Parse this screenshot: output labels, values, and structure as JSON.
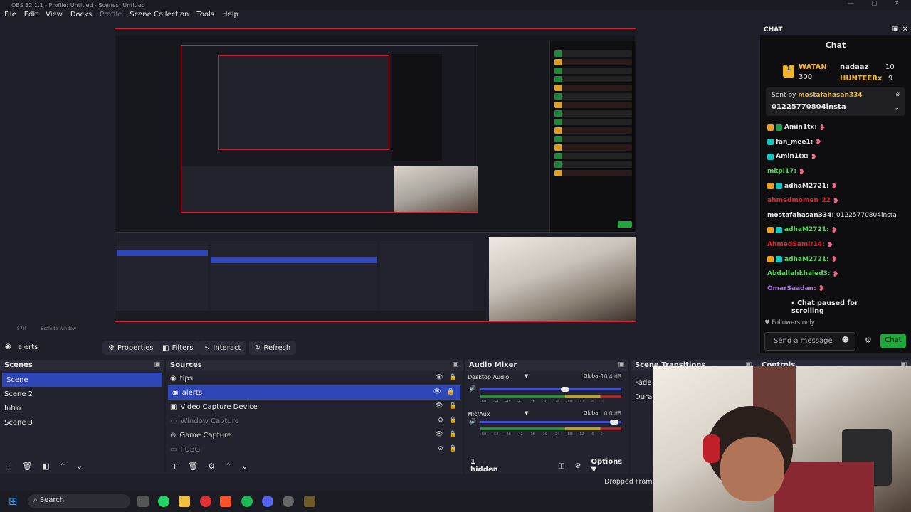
{
  "window": {
    "title": "OBS 32.1.1 - Profile: Untitled - Scenes: Untitled"
  },
  "menu": [
    "File",
    "Edit",
    "View",
    "Docks",
    "Profile",
    "Scene Collection",
    "Tools",
    "Help"
  ],
  "zoom": {
    "percent": "57%",
    "mode": "Scale to Window"
  },
  "toolbar": {
    "current_source": "alerts",
    "properties": "Properties",
    "filters": "Filters",
    "interact": "Interact",
    "refresh": "Refresh"
  },
  "scenes": {
    "title": "Scenes",
    "items": [
      "Scene",
      "Scene 2",
      "Intro",
      "Scene 3"
    ],
    "selected": "Scene"
  },
  "sources": {
    "title": "Sources",
    "items": [
      {
        "label": "tips",
        "icon": "browser-icon"
      },
      {
        "label": "alerts",
        "icon": "browser-icon"
      },
      {
        "label": "Video Capture Device",
        "icon": "camera-icon"
      },
      {
        "label": "Window Capture",
        "icon": "window-icon"
      },
      {
        "label": "Game Capture",
        "icon": "gamepad-icon"
      },
      {
        "label": "PUBG",
        "icon": "window-icon"
      }
    ],
    "selected": "alerts"
  },
  "mixer": {
    "title": "Audio Mixer",
    "channels": [
      {
        "name": "Desktop Audio",
        "scope": "Global",
        "db": "-10.4 dB",
        "level": 0.6
      },
      {
        "name": "Mic/Aux",
        "scope": "Global",
        "db": "0.0 dB",
        "level": 0.95
      }
    ],
    "ticks": [
      "-60",
      "-54",
      "-48",
      "-42",
      "-36",
      "-30",
      "-24",
      "-18",
      "-12",
      "-6",
      "0"
    ],
    "hidden": "1 hidden",
    "options": "Options"
  },
  "transitions": {
    "title": "Scene Transitions",
    "value": "Fade",
    "duration_label": "Duration"
  },
  "controls": {
    "title": "Controls"
  },
  "status": {
    "dropped": "Dropped Frames"
  },
  "taskbar": {
    "search": "Search"
  },
  "chat_dock": {
    "dock_title": "CHAT",
    "header": "Chat",
    "leaderboard": [
      {
        "name": "WATAN",
        "points": "300"
      },
      {
        "name": "nadaaz",
        "points": "10"
      },
      {
        "name": "HUNTEERx",
        "points": "9"
      }
    ],
    "pinned": {
      "sent_by_prefix": "Sent by",
      "sender": "mostafahasan334",
      "message": "01225770804insta"
    },
    "messages": [
      {
        "user": "Amin1tx:",
        "color": "#e6e6e6",
        "badges": [
          "by",
          "bg"
        ]
      },
      {
        "user": "fan_mee1:",
        "color": "#e6e6e6",
        "badges": [
          "bt"
        ]
      },
      {
        "user": "Amin1tx:",
        "color": "#e6e6e6",
        "badges": [
          "bt"
        ]
      },
      {
        "user": "mkpl17:",
        "color": "#5fd35f",
        "badges": []
      },
      {
        "user": "adhaM2721:",
        "color": "#e6e6e6",
        "badges": [
          "by",
          "bt"
        ]
      },
      {
        "user": "ahmedmomen_22",
        "color": "#e0222e",
        "badges": []
      },
      {
        "user": "mostafahasan334:",
        "color": "#e6e6e6",
        "badges": [],
        "text": "01225770804insta"
      },
      {
        "user": "adhaM2721:",
        "color": "#5fd35f",
        "badges": [
          "by",
          "bt"
        ]
      },
      {
        "user": "AhmedSamir14:",
        "color": "#e0222e",
        "badges": []
      },
      {
        "user": "adhaM2721:",
        "color": "#5fd35f",
        "badges": [
          "by",
          "bt"
        ]
      },
      {
        "user": "Abdallahkhaled3:",
        "color": "#5fd35f",
        "badges": []
      },
      {
        "user": "OmarSaadan:",
        "color": "#b37ae8",
        "badges": []
      }
    ],
    "paused": "Chat paused for scrolling",
    "followers": "Followers only",
    "input_placeholder": "Send a message",
    "send": "Chat"
  }
}
